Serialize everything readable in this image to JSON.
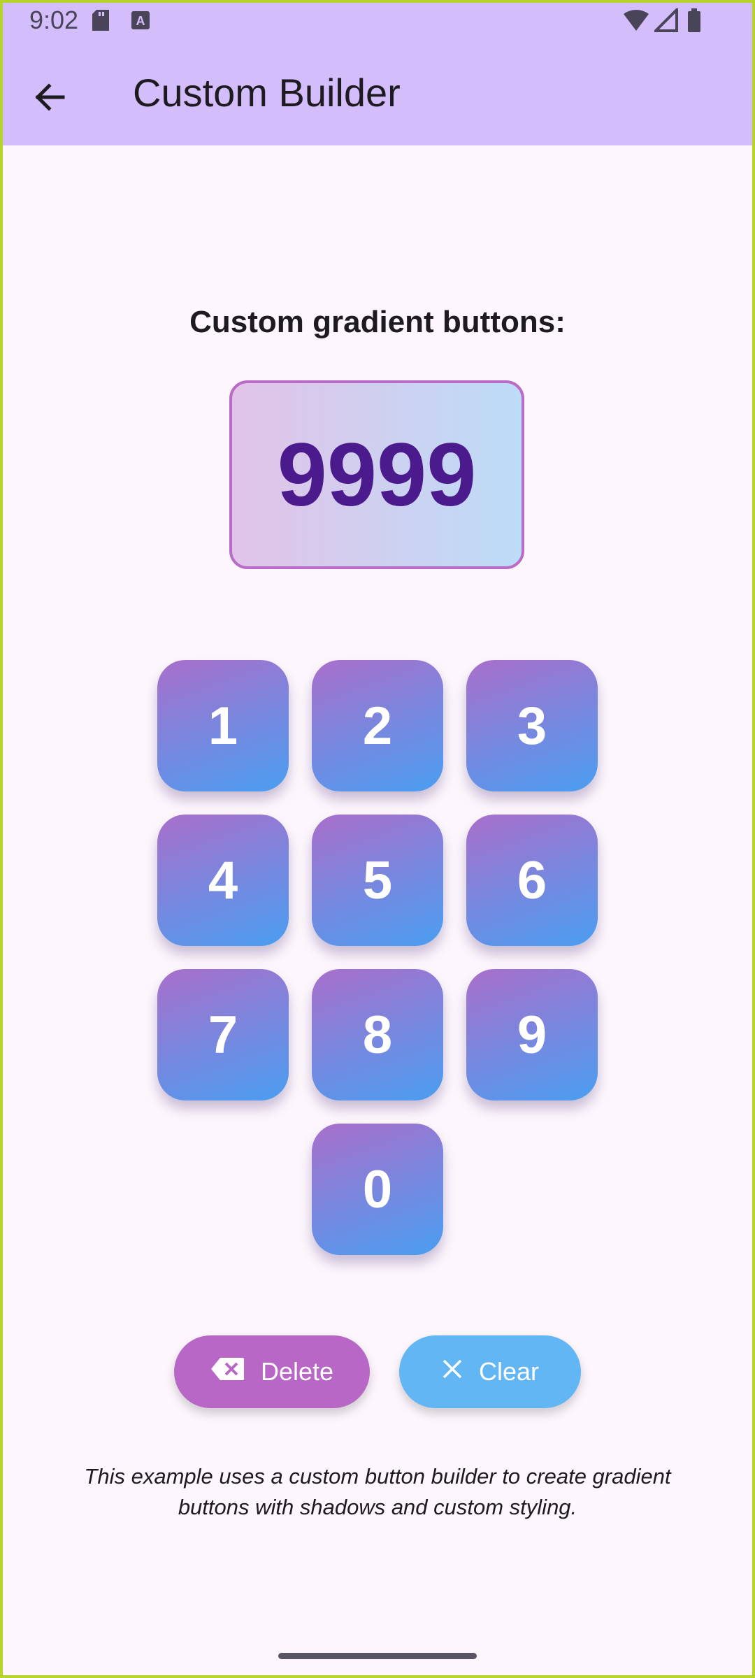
{
  "status_bar": {
    "time": "9:02"
  },
  "app_bar": {
    "title": "Custom Builder"
  },
  "section": {
    "heading": "Custom gradient buttons:"
  },
  "display": {
    "value": "9999"
  },
  "keypad": {
    "keys": [
      "1",
      "2",
      "3",
      "4",
      "5",
      "6",
      "7",
      "8",
      "9",
      "0"
    ]
  },
  "actions": {
    "delete_label": "Delete",
    "clear_label": "Clear"
  },
  "footer": {
    "note_line1": "This example uses a custom button builder to create gradient",
    "note_line2": "buttons with shadows and custom styling."
  },
  "colors": {
    "app_bar_bg": "#d3bdfb",
    "delete_button": "#b967c6",
    "clear_button": "#63b6f4",
    "display_text": "#4b1a8c"
  }
}
